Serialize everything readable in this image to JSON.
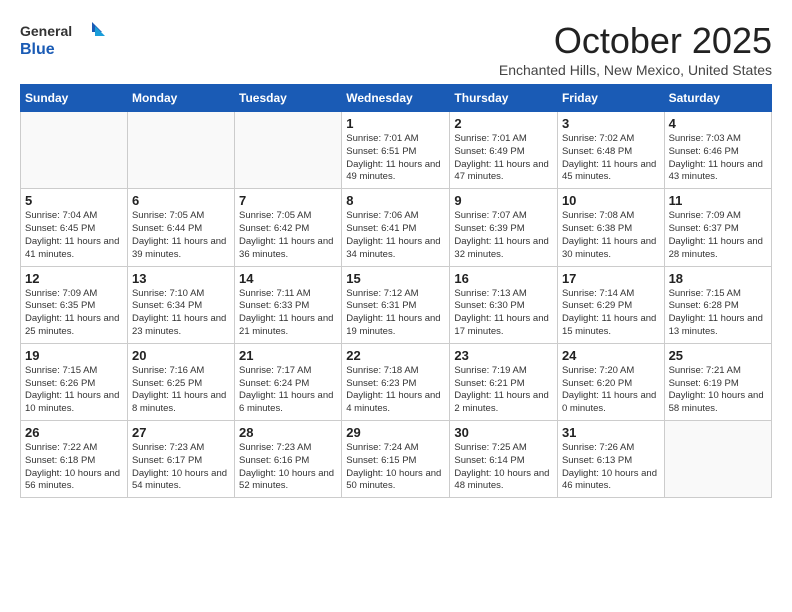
{
  "logo": {
    "general": "General",
    "blue": "Blue"
  },
  "header": {
    "month": "October 2025",
    "location": "Enchanted Hills, New Mexico, United States"
  },
  "weekdays": [
    "Sunday",
    "Monday",
    "Tuesday",
    "Wednesday",
    "Thursday",
    "Friday",
    "Saturday"
  ],
  "weeks": [
    [
      {
        "day": "",
        "text": ""
      },
      {
        "day": "",
        "text": ""
      },
      {
        "day": "",
        "text": ""
      },
      {
        "day": "1",
        "text": "Sunrise: 7:01 AM\nSunset: 6:51 PM\nDaylight: 11 hours and 49 minutes."
      },
      {
        "day": "2",
        "text": "Sunrise: 7:01 AM\nSunset: 6:49 PM\nDaylight: 11 hours and 47 minutes."
      },
      {
        "day": "3",
        "text": "Sunrise: 7:02 AM\nSunset: 6:48 PM\nDaylight: 11 hours and 45 minutes."
      },
      {
        "day": "4",
        "text": "Sunrise: 7:03 AM\nSunset: 6:46 PM\nDaylight: 11 hours and 43 minutes."
      }
    ],
    [
      {
        "day": "5",
        "text": "Sunrise: 7:04 AM\nSunset: 6:45 PM\nDaylight: 11 hours and 41 minutes."
      },
      {
        "day": "6",
        "text": "Sunrise: 7:05 AM\nSunset: 6:44 PM\nDaylight: 11 hours and 39 minutes."
      },
      {
        "day": "7",
        "text": "Sunrise: 7:05 AM\nSunset: 6:42 PM\nDaylight: 11 hours and 36 minutes."
      },
      {
        "day": "8",
        "text": "Sunrise: 7:06 AM\nSunset: 6:41 PM\nDaylight: 11 hours and 34 minutes."
      },
      {
        "day": "9",
        "text": "Sunrise: 7:07 AM\nSunset: 6:39 PM\nDaylight: 11 hours and 32 minutes."
      },
      {
        "day": "10",
        "text": "Sunrise: 7:08 AM\nSunset: 6:38 PM\nDaylight: 11 hours and 30 minutes."
      },
      {
        "day": "11",
        "text": "Sunrise: 7:09 AM\nSunset: 6:37 PM\nDaylight: 11 hours and 28 minutes."
      }
    ],
    [
      {
        "day": "12",
        "text": "Sunrise: 7:09 AM\nSunset: 6:35 PM\nDaylight: 11 hours and 25 minutes."
      },
      {
        "day": "13",
        "text": "Sunrise: 7:10 AM\nSunset: 6:34 PM\nDaylight: 11 hours and 23 minutes."
      },
      {
        "day": "14",
        "text": "Sunrise: 7:11 AM\nSunset: 6:33 PM\nDaylight: 11 hours and 21 minutes."
      },
      {
        "day": "15",
        "text": "Sunrise: 7:12 AM\nSunset: 6:31 PM\nDaylight: 11 hours and 19 minutes."
      },
      {
        "day": "16",
        "text": "Sunrise: 7:13 AM\nSunset: 6:30 PM\nDaylight: 11 hours and 17 minutes."
      },
      {
        "day": "17",
        "text": "Sunrise: 7:14 AM\nSunset: 6:29 PM\nDaylight: 11 hours and 15 minutes."
      },
      {
        "day": "18",
        "text": "Sunrise: 7:15 AM\nSunset: 6:28 PM\nDaylight: 11 hours and 13 minutes."
      }
    ],
    [
      {
        "day": "19",
        "text": "Sunrise: 7:15 AM\nSunset: 6:26 PM\nDaylight: 11 hours and 10 minutes."
      },
      {
        "day": "20",
        "text": "Sunrise: 7:16 AM\nSunset: 6:25 PM\nDaylight: 11 hours and 8 minutes."
      },
      {
        "day": "21",
        "text": "Sunrise: 7:17 AM\nSunset: 6:24 PM\nDaylight: 11 hours and 6 minutes."
      },
      {
        "day": "22",
        "text": "Sunrise: 7:18 AM\nSunset: 6:23 PM\nDaylight: 11 hours and 4 minutes."
      },
      {
        "day": "23",
        "text": "Sunrise: 7:19 AM\nSunset: 6:21 PM\nDaylight: 11 hours and 2 minutes."
      },
      {
        "day": "24",
        "text": "Sunrise: 7:20 AM\nSunset: 6:20 PM\nDaylight: 11 hours and 0 minutes."
      },
      {
        "day": "25",
        "text": "Sunrise: 7:21 AM\nSunset: 6:19 PM\nDaylight: 10 hours and 58 minutes."
      }
    ],
    [
      {
        "day": "26",
        "text": "Sunrise: 7:22 AM\nSunset: 6:18 PM\nDaylight: 10 hours and 56 minutes."
      },
      {
        "day": "27",
        "text": "Sunrise: 7:23 AM\nSunset: 6:17 PM\nDaylight: 10 hours and 54 minutes."
      },
      {
        "day": "28",
        "text": "Sunrise: 7:23 AM\nSunset: 6:16 PM\nDaylight: 10 hours and 52 minutes."
      },
      {
        "day": "29",
        "text": "Sunrise: 7:24 AM\nSunset: 6:15 PM\nDaylight: 10 hours and 50 minutes."
      },
      {
        "day": "30",
        "text": "Sunrise: 7:25 AM\nSunset: 6:14 PM\nDaylight: 10 hours and 48 minutes."
      },
      {
        "day": "31",
        "text": "Sunrise: 7:26 AM\nSunset: 6:13 PM\nDaylight: 10 hours and 46 minutes."
      },
      {
        "day": "",
        "text": ""
      }
    ]
  ]
}
